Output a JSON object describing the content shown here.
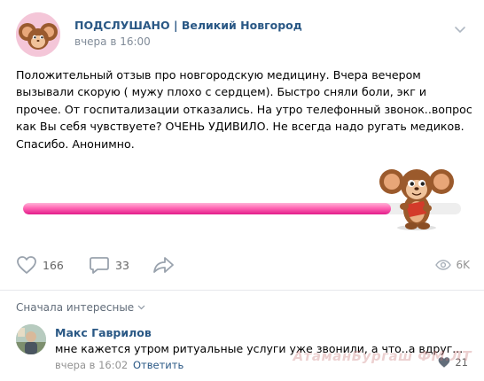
{
  "post": {
    "group_name": "ПОДСЛУШАНО | Великий Новгород",
    "time": "вчера в 16:00",
    "text": "Положительный отзыв про новгородскую медицину. Вчера вечером вызывали скорую ( мужу плохо с сердцем). Быстро сняли боли, экг и прочее. От госпитализации отказались. На утро телефонный звонок..вопрос как Вы себя чувствуете? ОЧЕНЬ УДИВИЛО. Не всегда надо ругать медиков. Спасибо. Анонимно.",
    "media": {
      "progress_fraction": 0.84,
      "colors": {
        "bar_light": "#ffb4d8",
        "bar_mid": "#ff66b3",
        "bar_dark": "#e21d8a"
      }
    }
  },
  "actions": {
    "likes": "166",
    "comments": "33",
    "views": "6K",
    "icons": [
      "heart-icon",
      "comment-icon",
      "share-icon",
      "eye-icon"
    ]
  },
  "comments_section": {
    "sort_label": "Сначала интересные"
  },
  "comment": {
    "author": "Макс Гаврилов",
    "text": "мне кажется утром ритуальные услуги уже звонили, а что..а вдруг...",
    "time": "вчера в 16:02",
    "reply_label": "Ответить",
    "likes": "21"
  },
  "watermark": "АтаманБургаш ФМ.ЛТ",
  "colors": {
    "link": "#2a5885",
    "secondary_text": "#818c99",
    "divider": "#e7e8ec"
  }
}
